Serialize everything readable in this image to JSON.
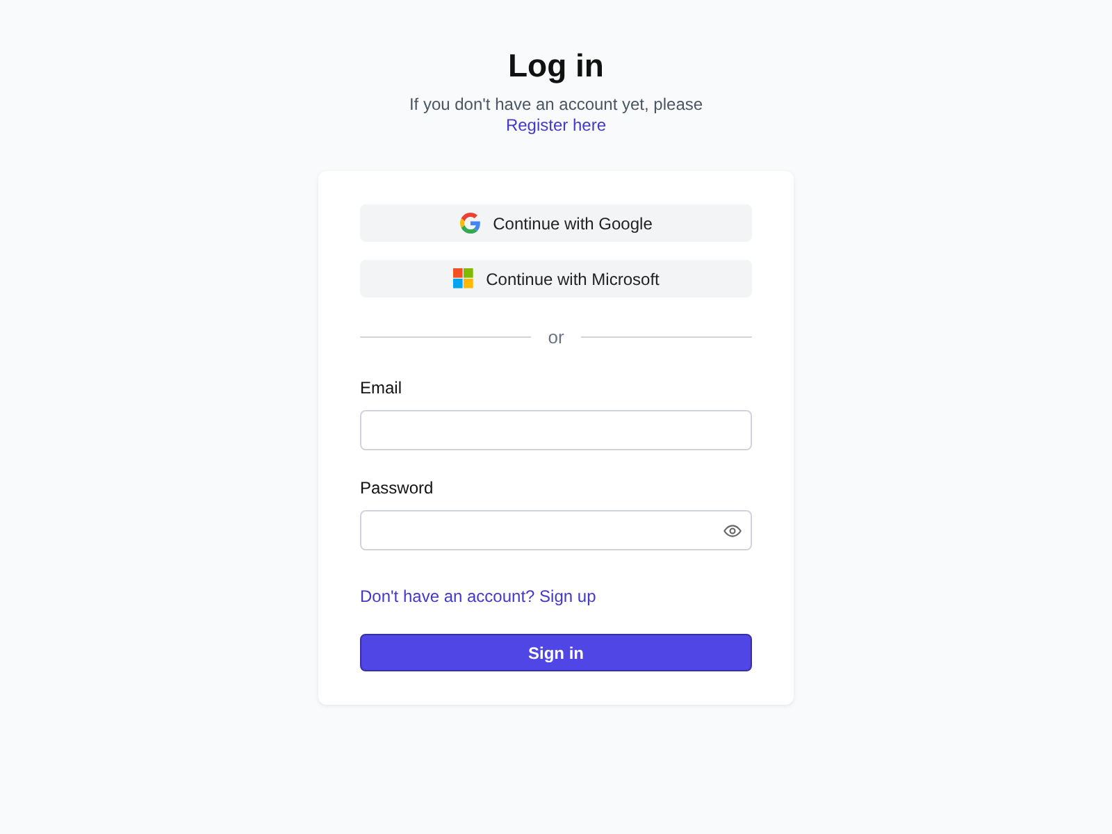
{
  "title": "Log in",
  "subtitle": "If you don't have an account yet, please",
  "register_link": "Register here",
  "providers": [
    {
      "kind": "google",
      "label": "Continue with Google"
    },
    {
      "kind": "microsoft",
      "label": "Continue with Microsoft"
    }
  ],
  "divider": "or",
  "fields": [
    {
      "kind": "email",
      "label": "Email"
    },
    {
      "kind": "password",
      "label": "Password"
    }
  ],
  "signup_link": "Don't have an account? Sign up",
  "submit": "Sign in"
}
